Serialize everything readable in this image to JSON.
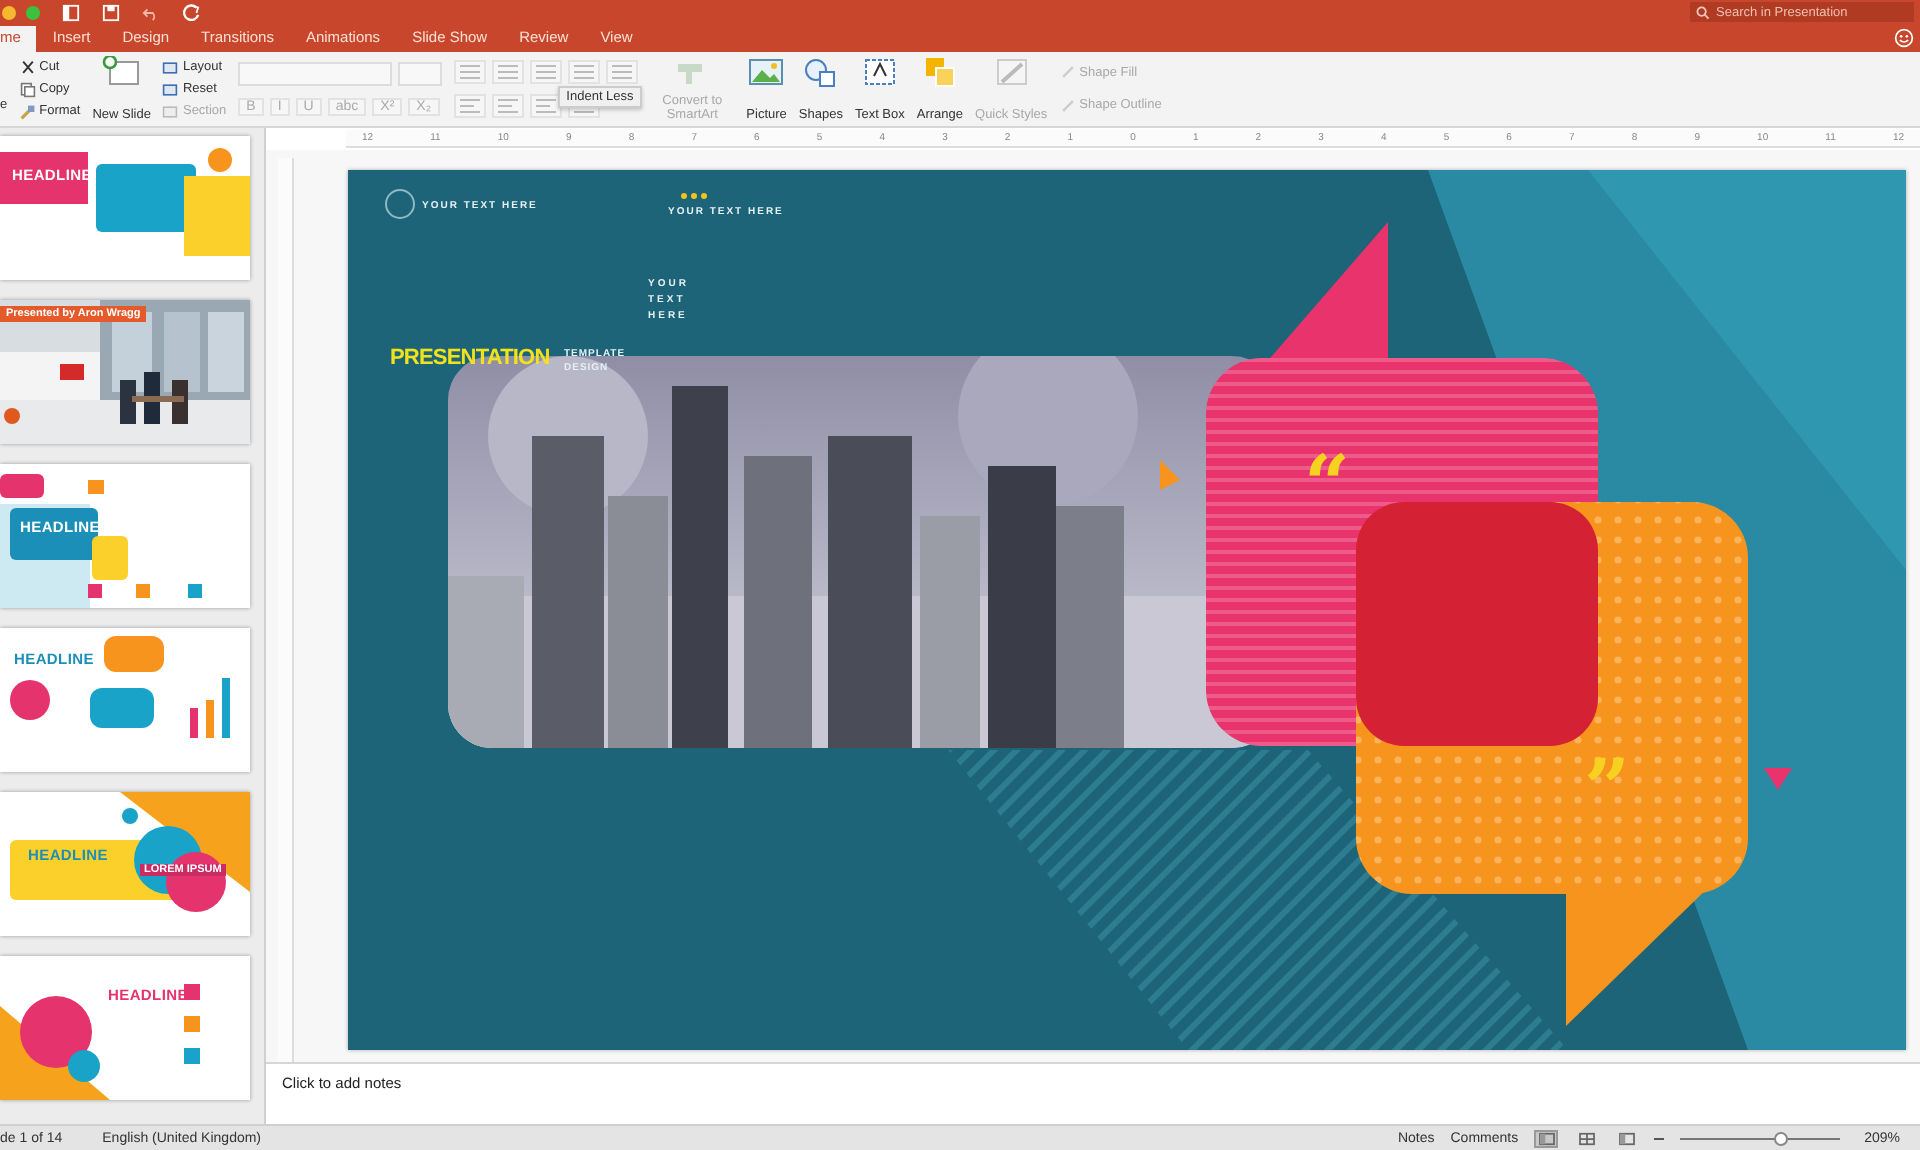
{
  "window": {
    "search": {
      "placeholder": "Search in Presentation"
    }
  },
  "tabs": [
    {
      "label": "me",
      "selected": true
    },
    {
      "label": "Insert",
      "selected": false
    },
    {
      "label": "Design",
      "selected": false
    },
    {
      "label": "Transitions",
      "selected": false
    },
    {
      "label": "Animations",
      "selected": false
    },
    {
      "label": "Slide Show",
      "selected": false
    },
    {
      "label": "Review",
      "selected": false
    },
    {
      "label": "View",
      "selected": false
    }
  ],
  "ribbon": {
    "paste": "e",
    "clipboard": [
      {
        "label": "Cut",
        "disabled": false
      },
      {
        "label": "Copy",
        "disabled": false
      },
      {
        "label": "Format",
        "disabled": false
      }
    ],
    "new_slide": "New Slide",
    "slide_options": [
      {
        "label": "Layout",
        "disabled": false
      },
      {
        "label": "Reset",
        "disabled": false
      },
      {
        "label": "Section",
        "disabled": true
      }
    ],
    "format_buttons": [
      "B",
      "I",
      "U",
      "abc",
      "X²",
      "X₂"
    ],
    "tooltip": "Indent Less",
    "insert_buttons": [
      {
        "label": "Convert to SmartArt",
        "disabled": true
      },
      {
        "label": "Picture",
        "disabled": false
      },
      {
        "label": "Shapes",
        "disabled": false
      },
      {
        "label": "Text Box",
        "disabled": false
      },
      {
        "label": "Arrange",
        "disabled": false
      },
      {
        "label": "Quick Styles",
        "disabled": true
      }
    ],
    "shape_options": [
      {
        "label": "Shape Fill",
        "disabled": true
      },
      {
        "label": "Shape Outline",
        "disabled": true
      }
    ]
  },
  "ruler": {
    "labels": [
      "12",
      "11",
      "10",
      "9",
      "8",
      "7",
      "6",
      "5",
      "4",
      "3",
      "2",
      "1",
      "0",
      "1",
      "2",
      "3",
      "4",
      "5",
      "6",
      "7",
      "8",
      "9",
      "10",
      "11",
      "12"
    ]
  },
  "thumbnails": [
    {
      "kind": "speech",
      "headline": "HEADLINE",
      "color": "#ffffff"
    },
    {
      "banner": "Presented by Aron Wragg"
    },
    {
      "kind": "callout",
      "headline": "HEADLINE",
      "color": "#ffffff"
    },
    {
      "kind": "bubbles",
      "headline": "HEADLINE",
      "color": "#1b8fb8"
    },
    {
      "kind": "lorem",
      "headline": "HEADLINE",
      "color": "#1b8fb8",
      "subtitle": "LOREM IPSUM"
    },
    {
      "kind": "circle",
      "headline": "HEADLINE",
      "color": "#e5336d"
    }
  ],
  "slide": {
    "corner_text": "YOUR TEXT HERE",
    "top_text": "YOUR TEXT HERE",
    "stacked_text": "YOUR\nTEXT\nHERE",
    "title": "PRESENTATION",
    "subtitle": "TEMPLATE\nDESIGN",
    "open_quote": "“",
    "close_quote": "”"
  },
  "notes": {
    "placeholder": "Click to add notes"
  },
  "status_bar": {
    "slide_counter": "de 1 of 14",
    "language": "English (United Kingdom)",
    "notes": "Notes",
    "comments": "Comments",
    "views": [
      {
        "selected": true
      },
      {
        "selected": false
      },
      {
        "selected": false
      }
    ],
    "zoom": {
      "level": 0.62,
      "reading": "209%"
    }
  }
}
